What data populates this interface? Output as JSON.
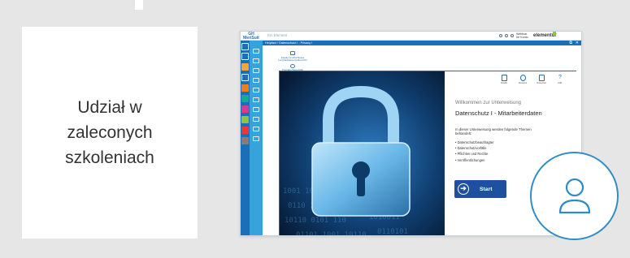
{
  "card": {
    "title": "Udział w zaleconych szkoleniach"
  },
  "app": {
    "logo_line1": "GH",
    "logo_line2": "MeriSuit",
    "search_placeholder": "Ein Element",
    "user_line1": "Webinar",
    "user_line2": "Ihr Konto",
    "brand": "elementur",
    "breadcrumb": "Helpfact / Datenschutz I - Privacy I",
    "close_glyph": "✕",
    "restore_glyph": "⧉"
  },
  "middle": {
    "item1_line1": "Details für Abschlüsse",
    "item1_line2": "Lernpfadweisungsübersicht",
    "item2_label": "Prioritäts-Weiterbildt"
  },
  "module": {
    "toolbar": [
      {
        "icon": "settings-icon",
        "label": "Details"
      },
      {
        "icon": "info-icon",
        "label": "Hinweise"
      },
      {
        "icon": "document-icon",
        "label": "Download"
      },
      {
        "icon": "help-icon",
        "label": "Hilfe"
      }
    ],
    "welcome": "Willkommen zur Unterweisung",
    "title": "Datenschutz I - Mitarbeiterdaten",
    "intro": "In dieser Unterweisung werden folgende Themen behandelt:",
    "topics": [
      "Datenschutzbeauftragter",
      "Datenschutzvorfälle",
      "Pflichten und Rechte",
      "Veröffentlichungen"
    ],
    "start_label": "Start"
  },
  "colors": {
    "accent": "#1c6fb6",
    "rail_light": "#37a3db",
    "start_button": "#1f4fa0",
    "avatar_ring": "#2f8bc6"
  }
}
